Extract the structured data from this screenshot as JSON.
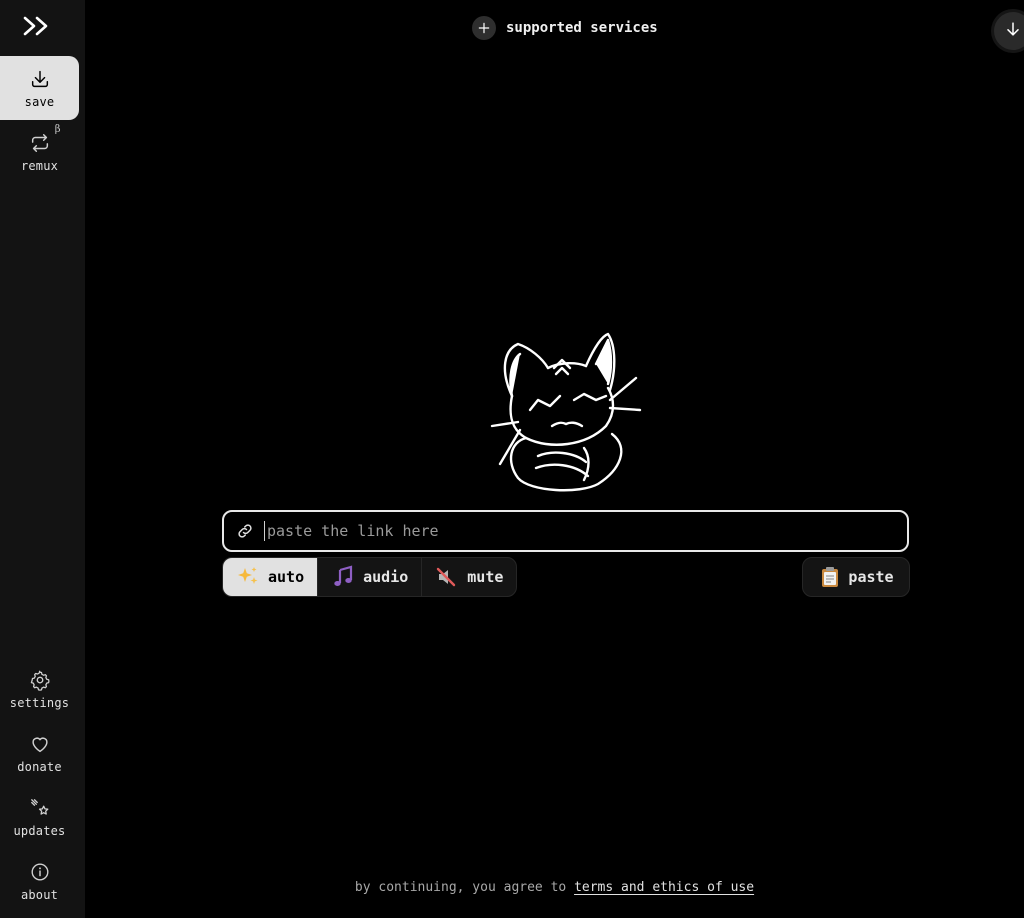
{
  "sidebar": {
    "logo": ">>",
    "items_top": [
      {
        "key": "save",
        "label": "save",
        "icon": "download-icon",
        "active": true
      },
      {
        "key": "remux",
        "label": "remux",
        "icon": "remux-icon",
        "badge": "β"
      }
    ],
    "items_bottom": [
      {
        "key": "settings",
        "label": "settings",
        "icon": "gear-icon"
      },
      {
        "key": "donate",
        "label": "donate",
        "icon": "heart-icon"
      },
      {
        "key": "updates",
        "label": "updates",
        "icon": "sparkle-star-icon"
      },
      {
        "key": "about",
        "label": "about",
        "icon": "info-icon"
      }
    ]
  },
  "header": {
    "supported_services": "supported services"
  },
  "input": {
    "placeholder": "paste the link here",
    "value": ""
  },
  "modes": [
    {
      "key": "auto",
      "label": "auto",
      "icon": "sparkles-emoji",
      "active": true
    },
    {
      "key": "audio",
      "label": "audio",
      "icon": "music-notes-emoji"
    },
    {
      "key": "mute",
      "label": "mute",
      "icon": "muted-speaker-emoji"
    }
  ],
  "paste": {
    "label": "paste",
    "icon": "clipboard-emoji"
  },
  "footer": {
    "prefix": "by continuing, you agree to",
    "link": "terms and ethics of use"
  },
  "colors": {
    "background": "#000000",
    "sidebar": "#131313",
    "active_item": "#e1e1e1",
    "button_bg": "#141414"
  }
}
